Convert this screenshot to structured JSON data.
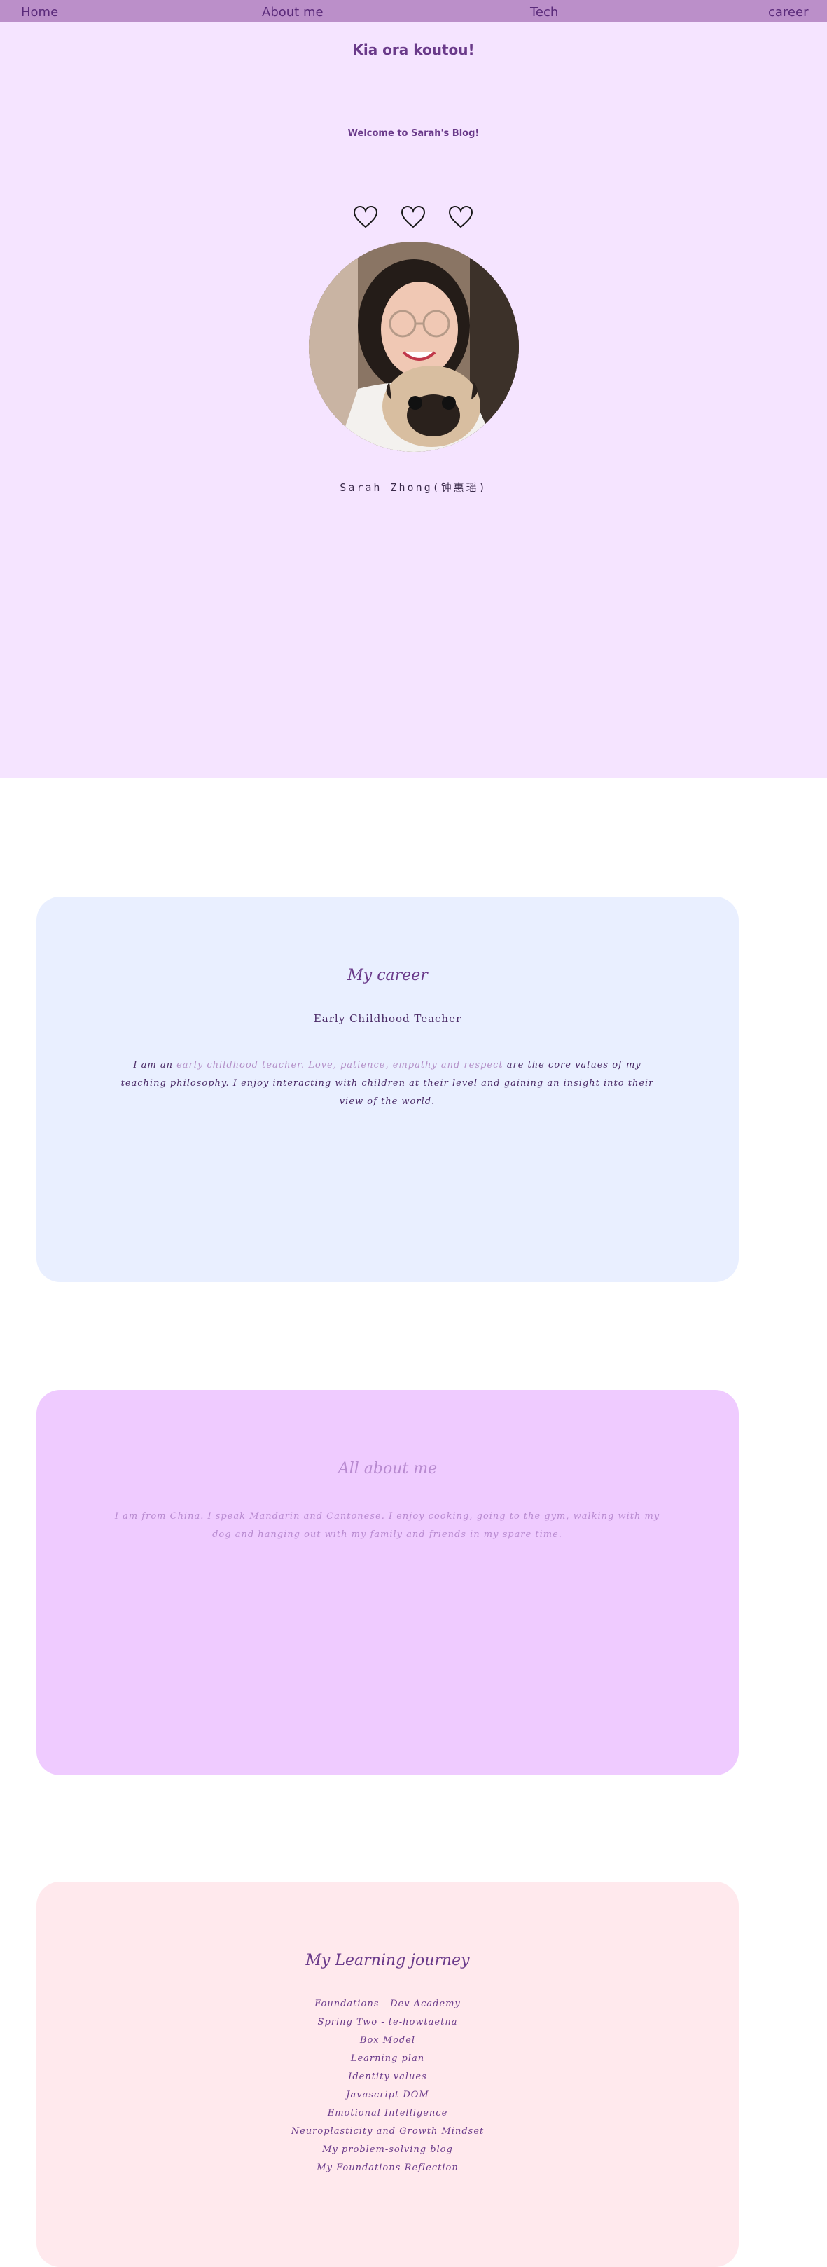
{
  "nav": {
    "home": "Home",
    "about": "About me",
    "tech": "Tech",
    "career": "career"
  },
  "hero": {
    "title": "Kia ora koutou!",
    "subtitle": "Welcome to Sarah's Blog!",
    "hearts_icon": "heart-outline-icon",
    "name": "Sarah Zhong(钟惠瑶)"
  },
  "career": {
    "title": "My career",
    "role": "Early Childhood Teacher",
    "p_intro": "I am an ",
    "p_highlight1": "early childhood teacher. Love, patience, empathy and respect",
    "p_middle": " are the core values of my teaching philosophy. I enjoy interacting with children at their level and gaining an insight into their view of the world."
  },
  "about": {
    "title": "All about me",
    "text": "I am from China. I speak Mandarin and Cantonese. I enjoy cooking, going to the gym, walking with my dog and hanging out with my family and friends in my spare time."
  },
  "learning": {
    "title": "My Learning journey",
    "items": [
      "Foundations - Dev Academy",
      "Spring Two - te-howtaetna",
      "Box Model",
      "Learning plan",
      "Identity values",
      "Javascript DOM",
      "Emotional Intelligence",
      "Neuroplasticity and Growth Mindset",
      "My problem-solving blog",
      "My Foundations-Reflection"
    ]
  },
  "colors": {
    "nav_bg": "#bb8fc9",
    "hero_bg": "#f5e4ff",
    "career_bg": "#e9efff",
    "about_bg": "#efcbff",
    "learning_bg": "#ffe9ed",
    "accent_text": "#6a3a8a"
  }
}
